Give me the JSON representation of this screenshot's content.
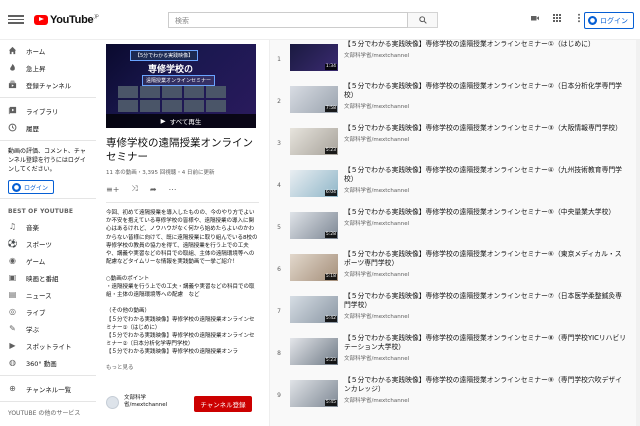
{
  "header": {
    "logo_text": "YouTube",
    "logo_region": "JP",
    "search_placeholder": "検索",
    "login_label": "ログイン",
    "icons": [
      "video-camera-icon",
      "apps-grid-icon",
      "more-vert-icon"
    ]
  },
  "sidebar": {
    "items_top": [
      {
        "label": "ホーム",
        "icon": "home-icon"
      },
      {
        "label": "急上昇",
        "icon": "fire-icon"
      },
      {
        "label": "登録チャンネル",
        "icon": "subscriptions-icon"
      }
    ],
    "items_lib": [
      {
        "label": "ライブラリ",
        "icon": "library-icon"
      },
      {
        "label": "履歴",
        "icon": "history-icon"
      }
    ],
    "prompt": "動画の評価、コメント、チャンネル登録を行うにはログインしてください。",
    "login_label": "ログイン",
    "best_heading": "BEST OF YOUTUBE",
    "best_items": [
      {
        "label": "音楽",
        "icon": "music-icon"
      },
      {
        "label": "スポーツ",
        "icon": "sports-icon"
      },
      {
        "label": "ゲーム",
        "icon": "gaming-icon"
      },
      {
        "label": "映画と番組",
        "icon": "movies-icon"
      },
      {
        "label": "ニュース",
        "icon": "news-icon"
      },
      {
        "label": "ライブ",
        "icon": "live-icon"
      },
      {
        "label": "学ぶ",
        "icon": "learning-icon"
      },
      {
        "label": "スポットライト",
        "icon": "spotlight-icon"
      },
      {
        "label": "360° 動画",
        "icon": "360-icon"
      }
    ],
    "channel_list_label": "チャンネル一覧",
    "footer": "YOUTUBE の他のサービス"
  },
  "playlist": {
    "thumb_badge": "【5分でわかる実践映像】",
    "thumb_title": "専修学校の",
    "thumb_subtitle": "遠隔授業オンラインセミナー",
    "play_all": "すべて再生",
    "title": "専修学校の遠隔授業オンラインセミナー",
    "meta": "11 本の動画・3,395 回視聴・4 日前に更新",
    "description": "今回、初めて遠隔授業を導入したものの、今のやり方でよいか不安を抱えている専修学校の皆様や、遠隔授業の導入に関心はあるけれど、ノウハウがなく何から始めたらよいのかわからない皆様に向けて、既に遠隔授業に取り組んでいる8校の専修学校の教員の協力を得て、遠隔授業を行う上での工夫や、講義や実習などの科目での取組、主体の遠隔環境等への配慮などタイムリーな情報を実践動画で一挙ご紹介！\n\n○動画のポイント\n・遠隔授業を行う上での工夫・講義や実習などの科目での取組・主体の遠隔環境等への配慮　など\n\n（その他の動画）\n【５分でわかる実践映像】専修学校の遠隔授業オンラインセミナー①（はじめに）\n【５分でわかる実践映像】専修学校の遠隔授業オンラインセミナー②（日本分析化学専門学校）\n【５分でわかる実践映像】専修学校の遠隔授業オンラ",
    "more_label": "もっと見る",
    "owner_name": "文部科学省/mextchannel",
    "subscribe_label": "チャンネル登録"
  },
  "videos": [
    {
      "index": "1",
      "title": "【５分でわかる実践映像】専修学校の遠隔授業オンラインセミナー①（はじめに）",
      "channel": "文部科学省/mextchannel",
      "duration": "1:34"
    },
    {
      "index": "2",
      "title": "【５分でわかる実践映像】専修学校の遠隔授業オンラインセミナー②（日本分析化学専門学校）",
      "channel": "文部科学省/mextchannel",
      "duration": "7:58"
    },
    {
      "index": "3",
      "title": "【５分でわかる実践映像】専修学校の遠隔授業オンラインセミナー③（大阪情報専門学校）",
      "channel": "文部科学省/mextchannel",
      "duration": "5:23"
    },
    {
      "index": "4",
      "title": "【５分でわかる実践映像】専修学校の遠隔授業オンラインセミナー④（九州技術教育専門学校）",
      "channel": "文部科学省/mextchannel",
      "duration": "6:04"
    },
    {
      "index": "5",
      "title": "【５分でわかる実践映像】専修学校の遠隔授業オンラインセミナー⑤（中央量業大学校）",
      "channel": "文部科学省/mextchannel",
      "duration": "5:28"
    },
    {
      "index": "6",
      "title": "【５分でわかる実践映像】専修学校の遠隔授業オンラインセミナー⑥（東京メディカル・スポーツ専門学校）",
      "channel": "文部科学省/mextchannel",
      "duration": "5:18"
    },
    {
      "index": "7",
      "title": "【５分でわかる実践映像】専修学校の遠隔授業オンラインセミナー⑦（日本医学柔整鍼灸専門学校）",
      "channel": "文部科学省/mextchannel",
      "duration": "5:42"
    },
    {
      "index": "8",
      "title": "【５分でわかる実践映像】専修学校の遠隔授業オンラインセミナー⑧（専門学校YICリハビリテーション大学校）",
      "channel": "文部科学省/mextchannel",
      "duration": "5:23"
    },
    {
      "index": "9",
      "title": "【５分でわかる実践映像】専修学校の遠隔授業オンラインセミナー⑨（専門学校穴吹デザインカレッジ）",
      "channel": "文部科学省/mextchannel",
      "duration": "5:45"
    }
  ]
}
